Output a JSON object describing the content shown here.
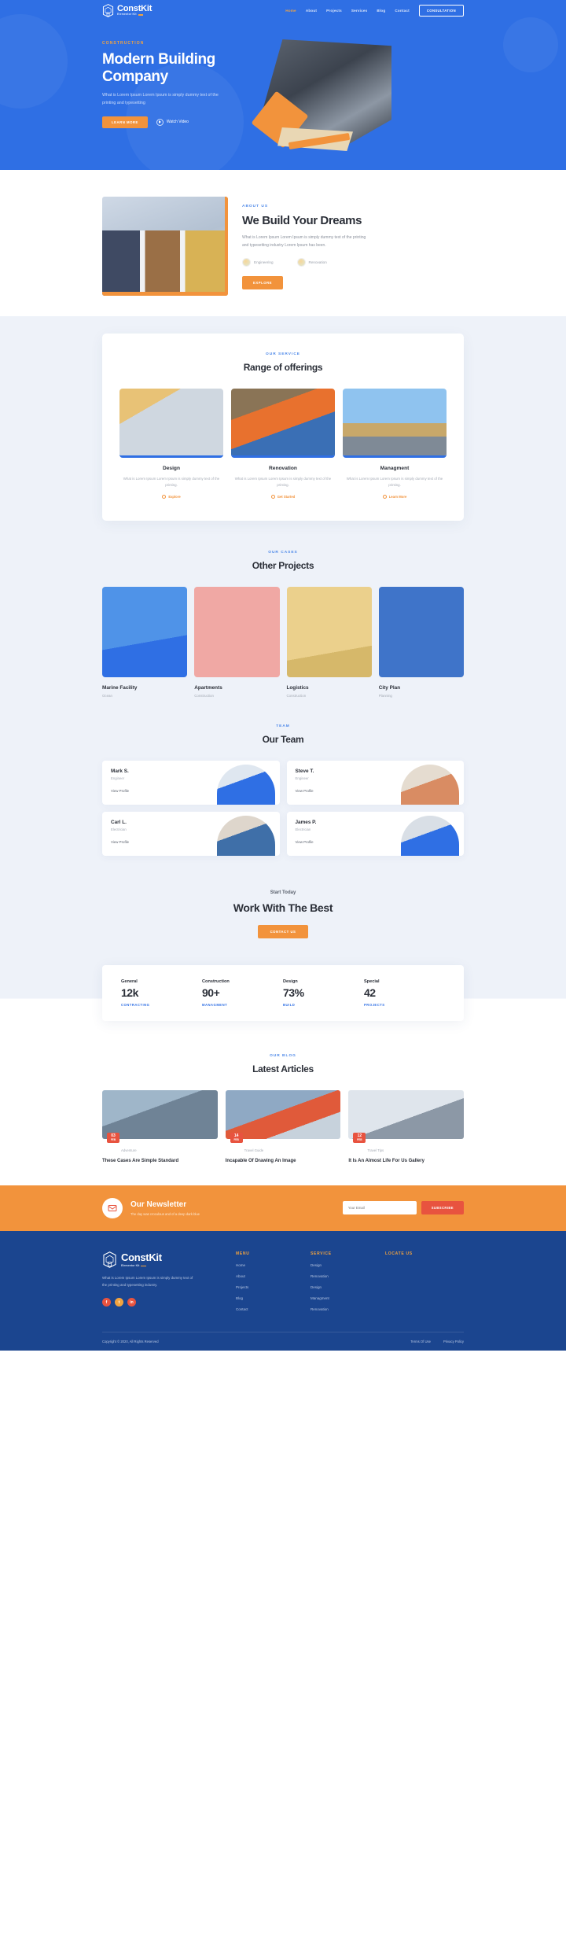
{
  "brand": {
    "name": "ConstKit",
    "sub": "Elementor Kit"
  },
  "nav": {
    "items": [
      {
        "label": "Home",
        "active": true
      },
      {
        "label": "About",
        "active": false
      },
      {
        "label": "Projects",
        "active": false
      },
      {
        "label": "Services",
        "active": false
      },
      {
        "label": "Blog",
        "active": false
      },
      {
        "label": "Contact",
        "active": false
      }
    ],
    "cta": "CONSULTATION"
  },
  "hero": {
    "eyebrow": "CONSTRUCTION",
    "title": "Modern Building Company",
    "desc": "What is Lorem Ipsum Lorem Ipsum is simply dummy text of the printing and typesetting",
    "primary_btn": "LEARN MORE",
    "video_label": "Watch Video"
  },
  "about": {
    "eyebrow": "ABOUT US",
    "title": "We Build Your Dreams",
    "desc": "What is Lorem Ipsum Lorem Ipsum is simply dummy text of the printing and typesetting industry Lorem Ipsum has been.",
    "features": [
      {
        "label": "Engineering"
      },
      {
        "label": "Renovation"
      }
    ],
    "btn": "EXPLORE"
  },
  "services": {
    "eyebrow": "OUR SERVICE",
    "title": "Range of offerings",
    "items": [
      {
        "title": "Design",
        "desc": "What is Lorem Ipsum Lorem Ipsum is simply dummy text of the printing.",
        "link": "Explore"
      },
      {
        "title": "Renovation",
        "desc": "What is Lorem Ipsum Lorem Ipsum is simply dummy text of the printing.",
        "link": "Get Started"
      },
      {
        "title": "Managment",
        "desc": "What is Lorem Ipsum Lorem Ipsum is simply dummy text of the printing.",
        "link": "Learn More"
      }
    ]
  },
  "projects": {
    "eyebrow": "OUR CASES",
    "title": "Other Projects",
    "items": [
      {
        "title": "Marine Facility",
        "cat": "Ocean"
      },
      {
        "title": "Apartments",
        "cat": "Construction"
      },
      {
        "title": "Logistics",
        "cat": "Construction"
      },
      {
        "title": "City Plan",
        "cat": "Planning"
      }
    ]
  },
  "team": {
    "eyebrow": "TEAM",
    "title": "Our Team",
    "members": [
      {
        "name": "Mark S.",
        "role": "Engineer",
        "link": "View Profile"
      },
      {
        "name": "Steve T.",
        "role": "Engineer",
        "link": "View Profile"
      },
      {
        "name": "Carl L.",
        "role": "Electrician",
        "link": "View Profile"
      },
      {
        "name": "James P.",
        "role": "Electrician",
        "link": "View Profile"
      }
    ]
  },
  "work": {
    "eyebrow": "Start Today",
    "title": "Work With The Best",
    "btn": "CONTACT US"
  },
  "chart_data": {
    "type": "table",
    "title": "Company statistics",
    "categories": [
      "General",
      "Construction",
      "Design",
      "Special"
    ],
    "values": [
      "12k",
      "90+",
      "73%",
      "42"
    ],
    "captions": [
      "CONTRACTING",
      "MANAGMENT",
      "BUILD",
      "PROJECTS"
    ]
  },
  "stats": [
    {
      "key": "General",
      "value": "12k",
      "caption": "CONTRACTING"
    },
    {
      "key": "Construction",
      "value": "90+",
      "caption": "MANAGMENT"
    },
    {
      "key": "Design",
      "value": "73%",
      "caption": "BUILD"
    },
    {
      "key": "Special",
      "value": "42",
      "caption": "PROJECTS"
    }
  ],
  "blog": {
    "eyebrow": "OUR BLOG",
    "title": "Latest Articles",
    "posts": [
      {
        "day": "03",
        "month": "FEB",
        "cat": "Adventure",
        "title": "These Cases Are Simple Standard"
      },
      {
        "day": "14",
        "month": "FEB",
        "cat": "Travel Guide",
        "title": "Incapable Of Drawing An Image"
      },
      {
        "day": "12",
        "month": "FEB",
        "cat": "Travel Tips",
        "title": "It Is An Almost Life For Us Gallery"
      }
    ]
  },
  "newsletter": {
    "title": "Our Newsletter",
    "desc": "The day was croculous and of a deep dark blue",
    "placeholder": "Your Email",
    "btn": "SUBSCRIBE"
  },
  "footer": {
    "desc": "What is Lorem Ipsum Lorem Ipsum is simply dummy text of the printing and typesetting industry.",
    "socials": [
      "f",
      "t",
      "in"
    ],
    "columns": [
      {
        "head": "MENU",
        "links": [
          "Home",
          "About",
          "Projects",
          "Blog",
          "Contact"
        ]
      },
      {
        "head": "SERVICE",
        "links": [
          "Design",
          "Renovation",
          "Design",
          "Managment",
          "Renovation"
        ]
      },
      {
        "head": "LOCATE US",
        "links": []
      }
    ],
    "copyright": "Copyright © 2020, All Rights Reserved",
    "terms": "Terms Of Use",
    "privacy": "Privacy Policy"
  }
}
